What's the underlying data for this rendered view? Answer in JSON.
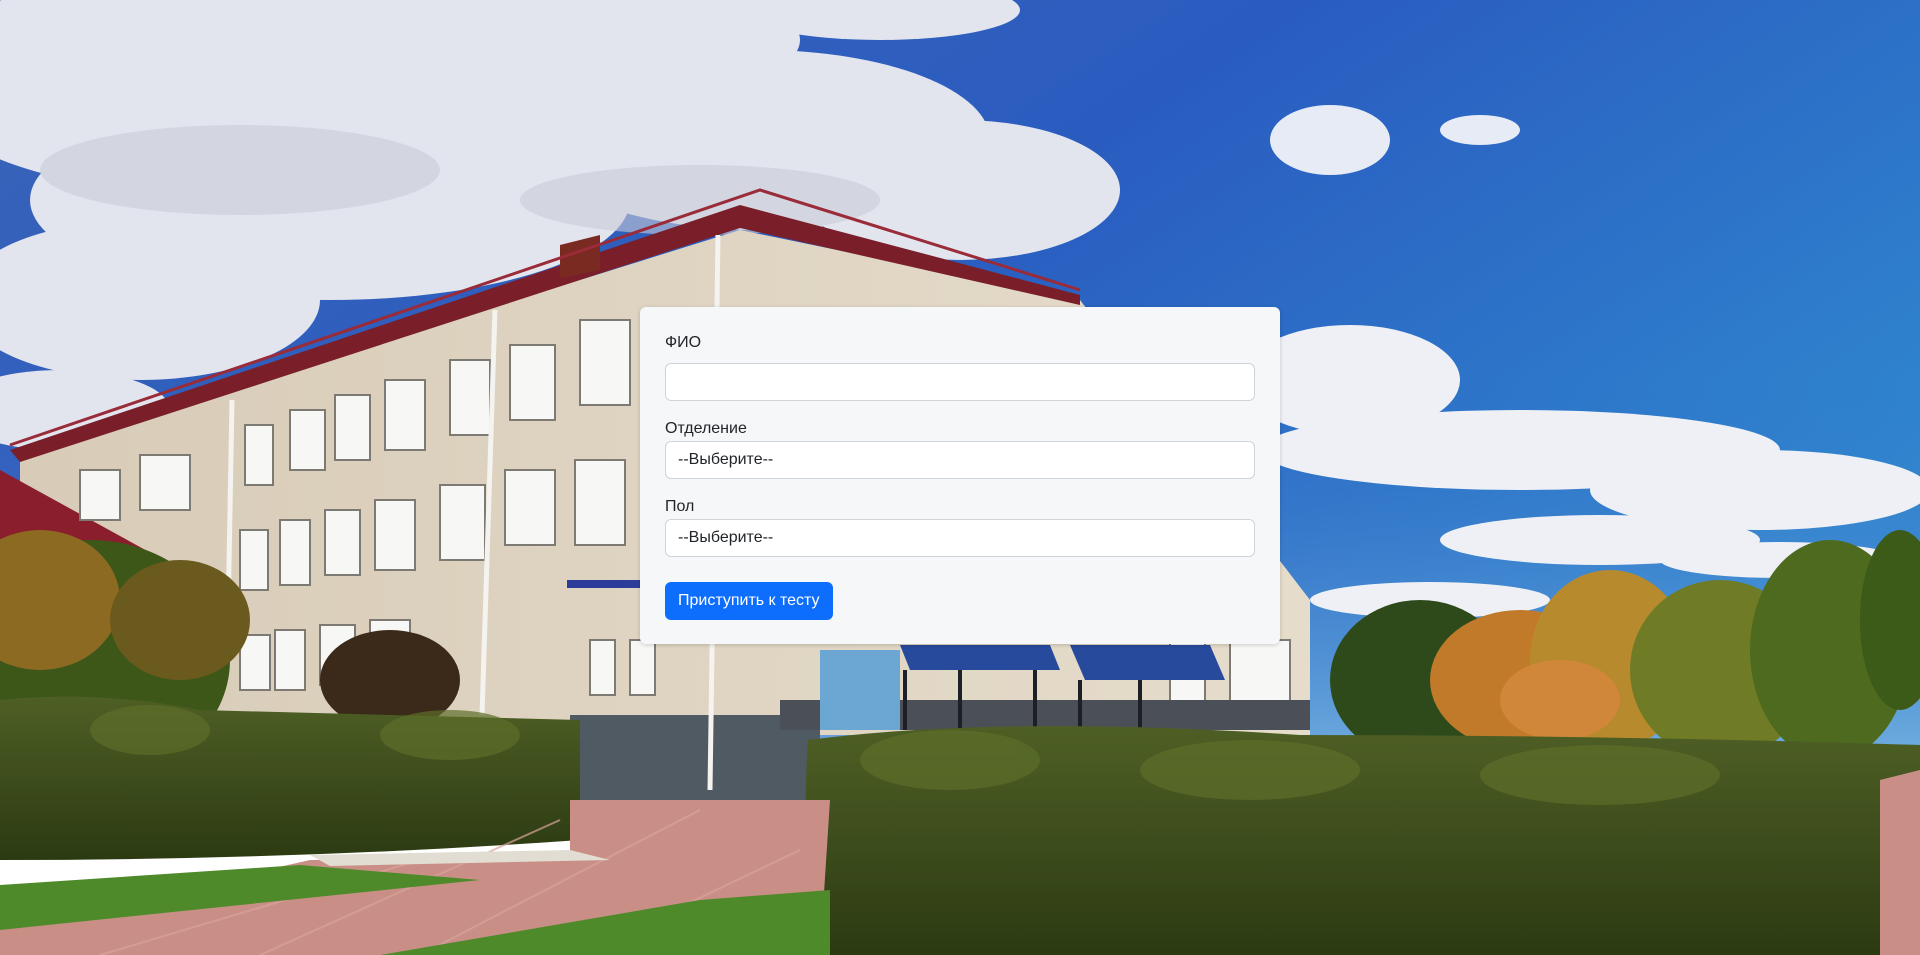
{
  "form": {
    "fio_label": "ФИО",
    "fio_value": "",
    "department_label": "Отделение",
    "department_selected": "--Выберите--",
    "gender_label": "Пол",
    "gender_selected": "--Выберите--",
    "submit_label": "Приступить к тесту"
  },
  "colors": {
    "accent": "#0d6efd",
    "card_background": "#f6f7f9"
  }
}
